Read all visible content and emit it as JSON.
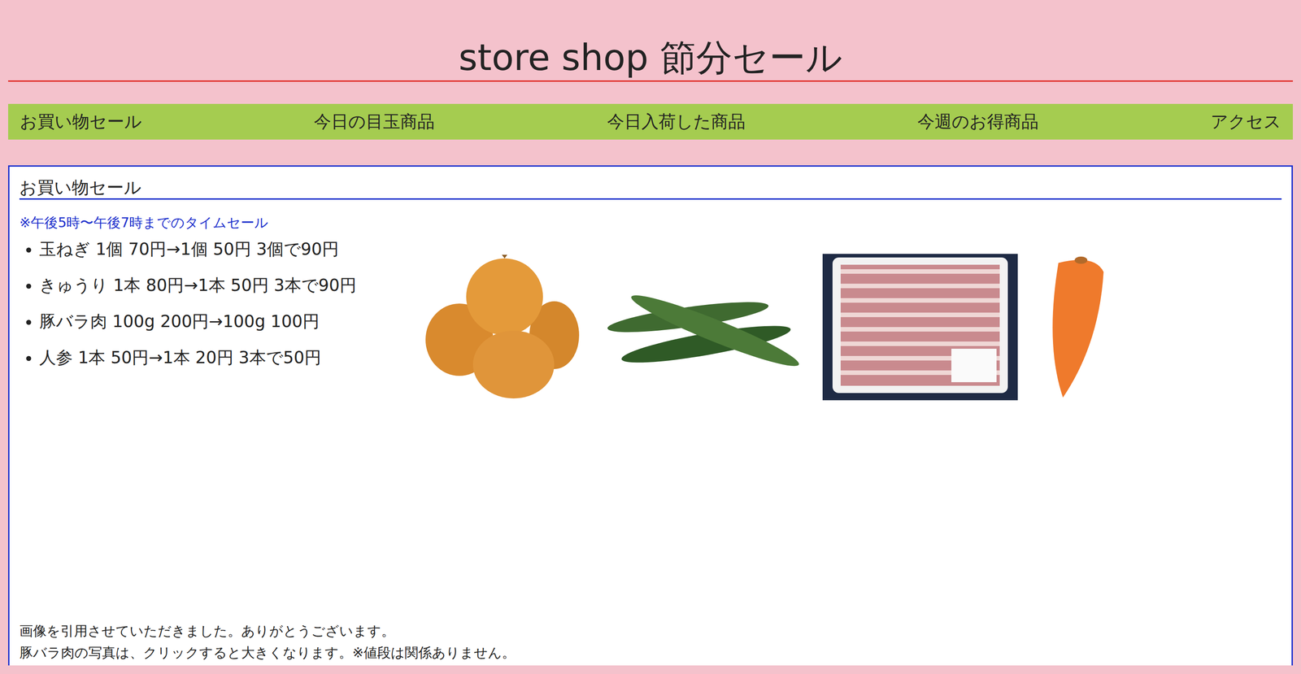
{
  "window": {
    "title": "store shop 節分セール"
  },
  "nav": {
    "items": [
      {
        "label": "お買い物セール"
      },
      {
        "label": "今日の目玉商品"
      },
      {
        "label": "今日入荷した商品"
      },
      {
        "label": "今週のお得商品"
      },
      {
        "label": "アクセス"
      }
    ]
  },
  "section": {
    "heading": "お買い物セール",
    "note": "※午後5時〜午後7時までのタイムセール",
    "items": [
      "玉ねぎ 1個 70円→1個 50円 3個で90円",
      "きゅうり 1本 80円→1本 50円 3本で90円",
      "豚バラ肉 100g 200円→100g 100円",
      "人参 1本 50円→1本 20円 3本で50円"
    ]
  },
  "footer": {
    "lines": [
      "画像を引用させていただきました。ありがとうございます。",
      "豚バラ肉の写真は、クリックすると大きくなります。※値段は関係ありません。"
    ]
  }
}
